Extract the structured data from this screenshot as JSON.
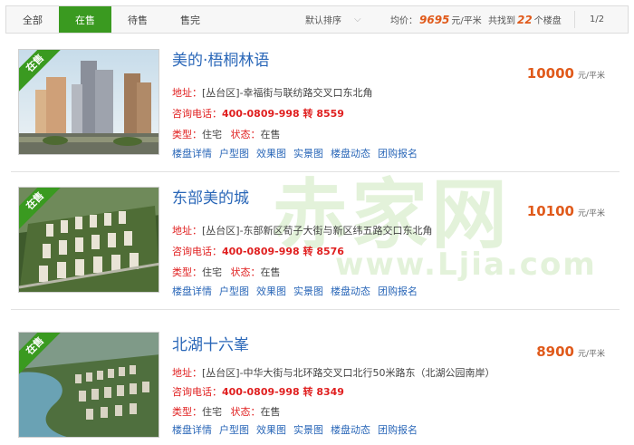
{
  "tabs": [
    {
      "label": "全部",
      "active": false
    },
    {
      "label": "在售",
      "active": true
    },
    {
      "label": "待售",
      "active": false
    },
    {
      "label": "售完",
      "active": false
    }
  ],
  "sort": {
    "label": "默认排序"
  },
  "summary": {
    "avg_prefix": "均价：",
    "avg_value": "9695",
    "avg_unit": "元/平米",
    "found_prefix": "共找到",
    "found_count": "22",
    "found_suffix": "个楼盘",
    "page": "1/2"
  },
  "watermark": {
    "text": "赤家网",
    "url": "www.Ljia.com"
  },
  "listings": [
    {
      "badge": "在售",
      "name": "美的·梧桐林语",
      "address_label": "地址：",
      "address": "[丛台区]-幸福街与联纺路交叉口东北角",
      "phone_label": "咨询电话：",
      "phone": "400-0809-998 转 8559",
      "type_label": "类型：",
      "type": "住宅",
      "status_label": "状态：",
      "status": "在售",
      "price": "10000",
      "price_unit": "元/平米",
      "links": [
        "楼盘详情",
        "户型图",
        "效果图",
        "实景图",
        "楼盘动态",
        "团购报名"
      ]
    },
    {
      "badge": "在售",
      "name": "东部美的城",
      "address_label": "地址：",
      "address": "[丛台区]-东部新区荀子大街与新区纬五路交口东北角",
      "phone_label": "咨询电话：",
      "phone": "400-0809-998 转 8576",
      "type_label": "类型：",
      "type": "住宅",
      "status_label": "状态：",
      "status": "在售",
      "price": "10100",
      "price_unit": "元/平米",
      "links": [
        "楼盘详情",
        "户型图",
        "效果图",
        "实景图",
        "楼盘动态",
        "团购报名"
      ]
    },
    {
      "badge": "在售",
      "name": "北湖十六峯",
      "address_label": "地址：",
      "address": "[丛台区]-中华大街与北环路交叉口北行50米路东（北湖公园南岸）",
      "phone_label": "咨询电话：",
      "phone": "400-0809-998 转 8349",
      "type_label": "类型：",
      "type": "住宅",
      "status_label": "状态：",
      "status": "在售",
      "price": "8900",
      "price_unit": "元/平米",
      "links": [
        "楼盘详情",
        "户型图",
        "效果图",
        "实景图",
        "楼盘动态",
        "团购报名"
      ]
    }
  ]
}
